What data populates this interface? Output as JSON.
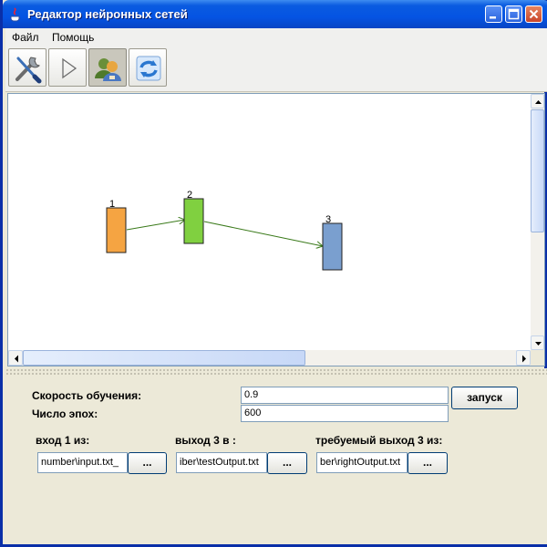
{
  "window": {
    "title": "Редактор нейронных сетей"
  },
  "menu": [
    "Файл",
    "Помощь"
  ],
  "toolbar": {
    "tools": [
      "settings-tools-icon",
      "run-play-icon",
      "users-icon",
      "refresh-icon"
    ],
    "pressed_tool": "users-icon"
  },
  "network": {
    "nodes": [
      {
        "label": "1",
        "color": "#f5a442"
      },
      {
        "label": "2",
        "color": "#80d040"
      },
      {
        "label": "3",
        "color": "#7a9fcf"
      }
    ],
    "edges": [
      {
        "from": "1",
        "to": "2"
      },
      {
        "from": "2",
        "to": "3"
      }
    ],
    "edge_color": "#3a7a1a"
  },
  "form": {
    "learning_rate_label": "Скорость обучения:",
    "learning_rate_value": "0.9",
    "epochs_label": "Число эпох:",
    "epochs_value": "600",
    "run_button": "запуск",
    "input_label": "вход 1 из:",
    "input_value": "_number\\input.txt",
    "output_label": "выход 3 в :",
    "output_value": "iber\\testOutput.txt",
    "required_label": "требуемый выход 3 из:",
    "required_value": "ber\\rightOutput.txt",
    "browse_label": "..."
  }
}
